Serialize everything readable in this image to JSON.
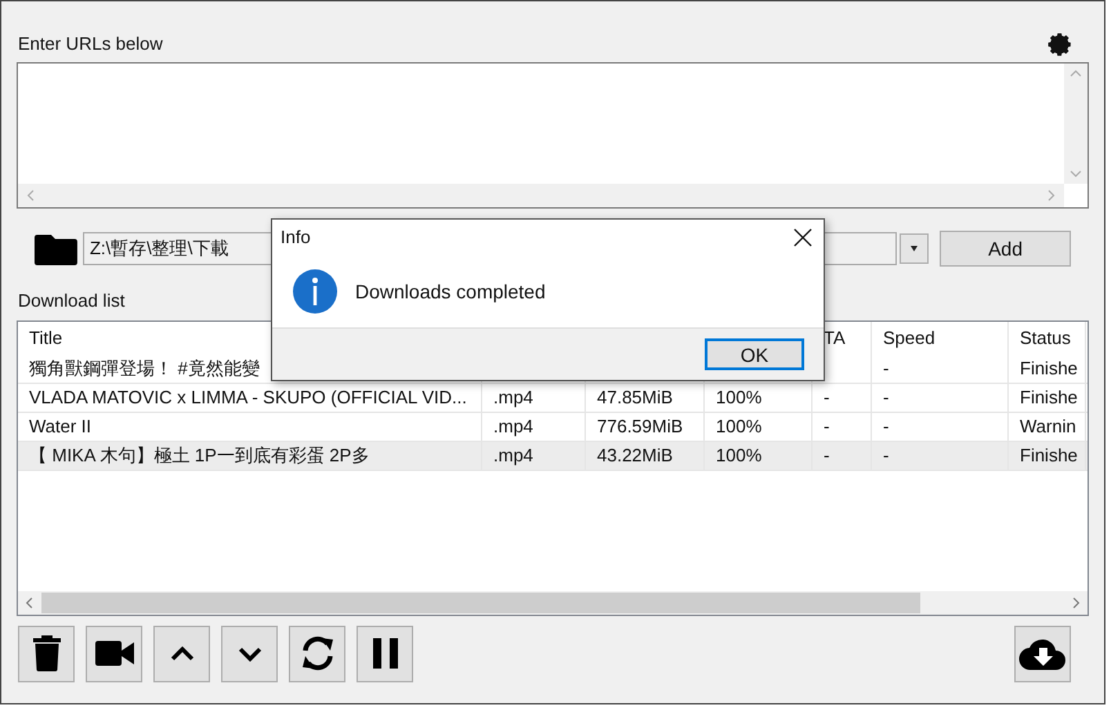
{
  "url_section": {
    "label": "Enter URLs below"
  },
  "output": {
    "path": "Z:\\暫存\\整理\\下載",
    "add_button": "Add"
  },
  "download_list": {
    "label": "Download list",
    "columns": [
      "Title",
      null,
      null,
      null,
      "TA",
      "Speed",
      "Status"
    ],
    "rows": [
      {
        "selected": false,
        "cells": [
          "獨角獸鋼彈登場！ #竟然能變",
          null,
          null,
          null,
          null,
          "-",
          "Finishe"
        ]
      },
      {
        "selected": false,
        "cells": [
          "VLADA MATOVIC x LIMMA - SKUPO (OFFICIAL VID...",
          ".mp4",
          "47.85MiB",
          "100%",
          "-",
          "-",
          "Finishe"
        ]
      },
      {
        "selected": false,
        "cells": [
          "Water II",
          ".mp4",
          "776.59MiB",
          "100%",
          "-",
          "-",
          "Warnin"
        ]
      },
      {
        "selected": true,
        "cells": [
          "【 MIKA 木句】極土  1P一到底有彩蛋 2P多",
          ".mp4",
          "43.22MiB",
          "100%",
          "-",
          "-",
          "Finishe"
        ]
      }
    ]
  },
  "dialog": {
    "title": "Info",
    "message": "Downloads completed",
    "ok_button": "OK"
  }
}
